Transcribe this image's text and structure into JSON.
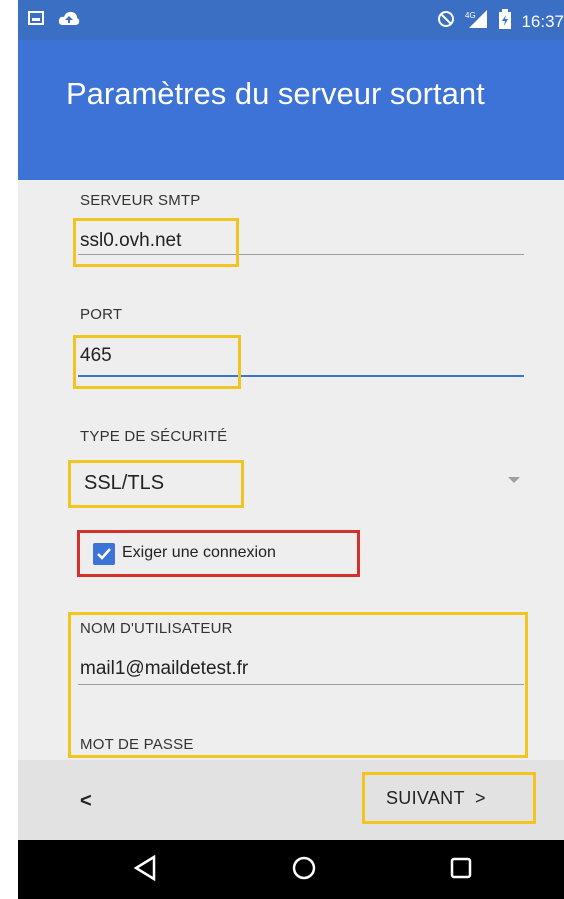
{
  "status_bar": {
    "time": "16:37",
    "network": "4G",
    "icons": [
      "gallery-icon",
      "cloud-upload-icon",
      "do-not-disturb-icon",
      "signal-icon",
      "battery-icon"
    ]
  },
  "header": {
    "title": "Paramètres du serveur sortant"
  },
  "form": {
    "smtp_label": "SERVEUR SMTP",
    "smtp_value": "ssl0.ovh.net",
    "port_label": "PORT",
    "port_value": "465",
    "security_label": "TYPE DE SÉCURITÉ",
    "security_value": "SSL/TLS",
    "require_login_label": "Exiger une connexion",
    "require_login_checked": true,
    "username_label": "NOM D'UTILISATEUR",
    "username_value": "mail1@maildetest.fr",
    "password_label": "MOT DE PASSE"
  },
  "footer": {
    "back_label": "<",
    "next_label": "SUIVANT  >"
  },
  "nav": {
    "icons": [
      "back-triangle-icon",
      "home-circle-icon",
      "recents-square-icon"
    ]
  },
  "colors": {
    "header": "#3d72d6",
    "highlight_yellow": "#f2c41f",
    "highlight_red": "#d4302c",
    "background": "#eeeeee"
  }
}
